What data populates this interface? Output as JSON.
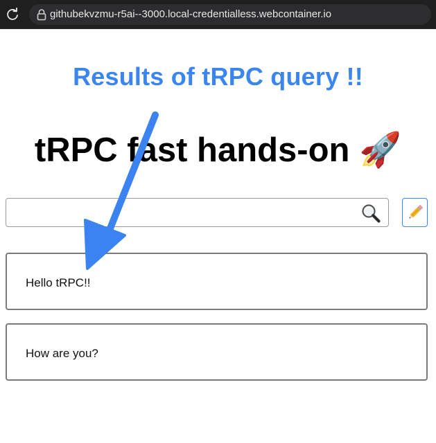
{
  "browser": {
    "url": "githubekvzmu-r5ai--3000.local-credentialless.webcontainer.io",
    "reload_icon": "reload-icon",
    "lock_icon": "lock-icon"
  },
  "annotation": {
    "text": "Results of tRPC query !!",
    "color": "#3b86ee"
  },
  "page": {
    "title": "tRPC fast hands-on 🚀"
  },
  "search": {
    "value": "",
    "placeholder": "",
    "icon": "magnifying-glass-icon"
  },
  "edit_button": {
    "icon": "pencil-icon"
  },
  "messages": [
    {
      "text": "Hello tRPC!!"
    },
    {
      "text": "How are you?"
    }
  ]
}
